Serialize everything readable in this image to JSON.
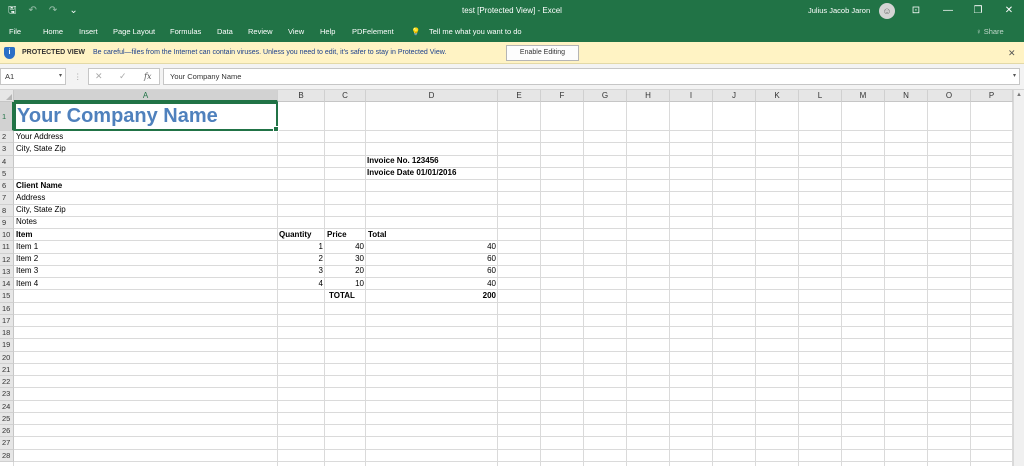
{
  "window": {
    "title": "test  [Protected View]  -  Excel",
    "user": "Julius Jacob Jaron",
    "avatar_glyph": "☺",
    "controls": {
      "ribbon_display": "⊡",
      "minimize": "—",
      "restore": "❐",
      "close": "✕"
    }
  },
  "qat": {
    "save_icon": "🖫",
    "undo_icon": "↶",
    "redo_icon": "↷",
    "customize_icon": "⌄"
  },
  "ribbon": {
    "tabs": [
      "File",
      "Home",
      "Insert",
      "Page Layout",
      "Formulas",
      "Data",
      "Review",
      "View",
      "Help",
      "PDFelement"
    ],
    "tell_me_icon": "💡",
    "tell_me": "Tell me what you want to do",
    "share": "♀ Share"
  },
  "protected_view": {
    "label": "PROTECTED VIEW",
    "message": "Be careful—files from the Internet can contain viruses. Unless you need to edit, it's safer to stay in Protected View.",
    "button": "Enable Editing",
    "close": "✕"
  },
  "formula_bar": {
    "name_box": "A1",
    "dropdown": "▾",
    "separator": "⋮",
    "cancel_icon": "✕",
    "enter_icon": "✓",
    "fx_icon": "fx",
    "formula": "Your Company Name"
  },
  "sheet": {
    "columns": [
      "A",
      "B",
      "C",
      "D",
      "E",
      "F",
      "G",
      "H",
      "I",
      "J",
      "K",
      "L",
      "M",
      "N",
      "O",
      "P"
    ],
    "rows": [
      "1",
      "2",
      "3",
      "4",
      "5",
      "6",
      "7",
      "8",
      "9",
      "10",
      "11",
      "12",
      "13",
      "14",
      "15",
      "16",
      "17",
      "18",
      "19",
      "20",
      "21",
      "22",
      "23",
      "24",
      "25",
      "26",
      "27",
      "28"
    ],
    "selected_cell": "A1",
    "company_name": "Your Company Name",
    "cells": {
      "a2": "Your Address",
      "a3": "City, State Zip",
      "d4": "Invoice No. 123456",
      "d5": "Invoice Date 01/01/2016",
      "a6": "Client Name",
      "a7": "Address",
      "a8": "City, State Zip",
      "a9": "Notes",
      "a10": "Item",
      "b10": "Quantity",
      "c10": "Price",
      "d10": "Total",
      "a11": "Item 1",
      "b11": "1",
      "c11": "40",
      "d11": "40",
      "a12": "Item 2",
      "b12": "2",
      "c12": "30",
      "d12": "60",
      "a13": "Item 3",
      "b13": "3",
      "c13": "20",
      "d13": "60",
      "a14": "Item 4",
      "b14": "4",
      "c14": "10",
      "d14": "40",
      "c15": "TOTAL",
      "d15": "200"
    }
  }
}
